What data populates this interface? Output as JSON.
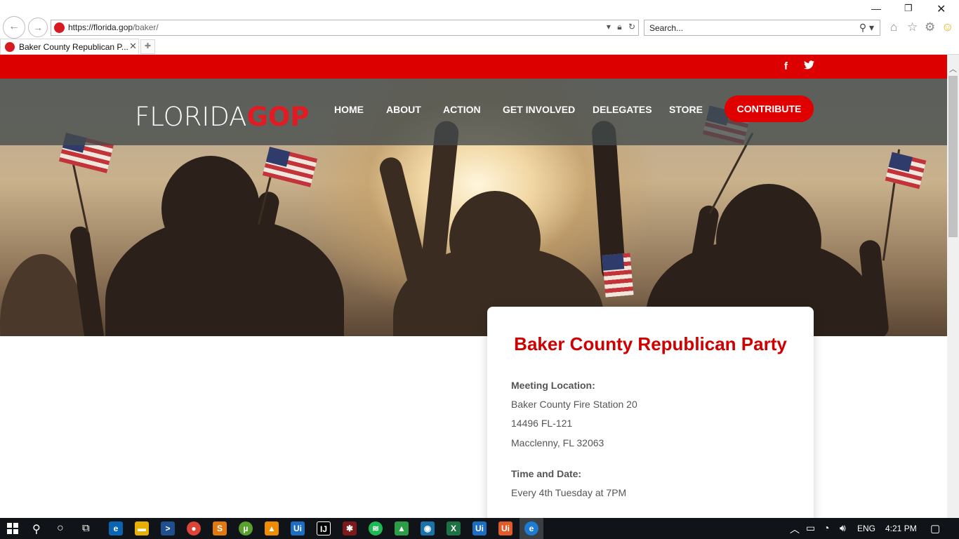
{
  "browser": {
    "url_host": "https://florida.gop",
    "url_path": "/baker/",
    "search_placeholder": "Search...",
    "tab_title": "Baker County Republican P...",
    "window_controls": {
      "minimize": "—",
      "maximize": "❐",
      "close": "✕"
    }
  },
  "site": {
    "logo_text": "FLORIDA",
    "logo_accent": "GOP",
    "social": [
      {
        "name": "facebook-icon",
        "glyph": "f"
      },
      {
        "name": "twitter-icon",
        "glyph": "🐦"
      }
    ],
    "nav": {
      "home": "HOME",
      "about": "ABOUT",
      "action": "ACTION",
      "get_involved": "GET INVOLVED",
      "delegates": "DELEGATES",
      "store": "STORE",
      "contribute": "CONTRIBUTE"
    },
    "colors": {
      "brand_red": "#dd0000",
      "nav_band": "#424a4c",
      "title_red": "#d00000"
    }
  },
  "card": {
    "title": "Baker County Republican Party",
    "meeting_label": "Meeting Location:",
    "location_line1": "Baker County Fire Station 20",
    "location_line2": "14496 FL-121",
    "location_line3": "Macclenny, FL 32063",
    "time_label": "Time and Date:",
    "time_value": "Every 4th Tuesday at 7PM"
  },
  "taskbar": {
    "language": "ENG",
    "time": "4:21 PM"
  }
}
